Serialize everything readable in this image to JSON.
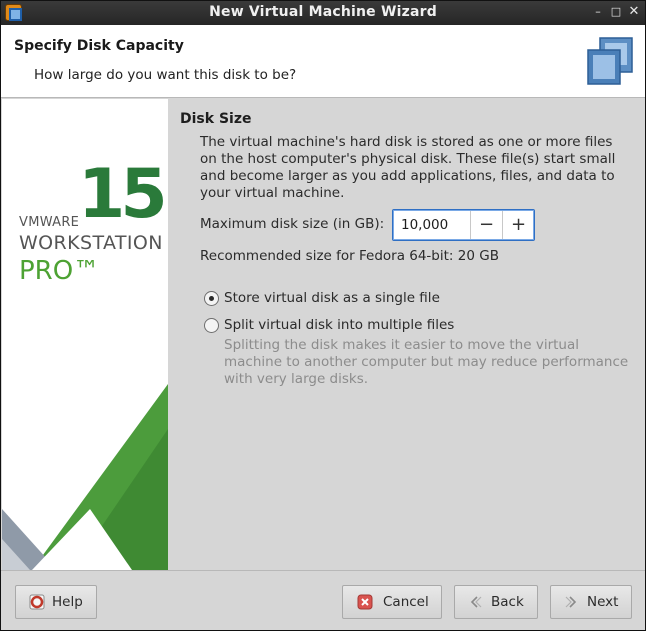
{
  "window": {
    "title": "New Virtual Machine Wizard",
    "min_glyph": "–",
    "max_glyph": "□",
    "close_glyph": "✕"
  },
  "header": {
    "title": "Specify Disk Capacity",
    "subtitle": "How large do you want this disk to be?"
  },
  "banner": {
    "version": "15",
    "brand": "VMWARE",
    "product": "WORKSTATION",
    "edition": "PRO™",
    "accent_green": "#4da233",
    "dark_green": "#2a7a3a"
  },
  "content": {
    "section_title": "Disk Size",
    "description": "The virtual machine's hard disk is stored as one or more files on the host computer's physical disk. These file(s) start small and become larger as you add applications, files, and data to your virtual machine.",
    "max_size_label": "Maximum disk size (in GB):",
    "max_size_value": "10,000",
    "decrement_glyph": "−",
    "increment_glyph": "+",
    "recommended": "Recommended size for Fedora 64-bit: 20 GB",
    "options": [
      {
        "label": "Store virtual disk as a single file",
        "selected": true
      },
      {
        "label": "Split virtual disk into multiple files",
        "selected": false
      }
    ],
    "split_note": "Splitting the disk makes it easier to move the virtual machine to another computer but may reduce performance with very large disks."
  },
  "footer": {
    "help_label": "Help",
    "cancel_label": "Cancel",
    "back_label": "Back",
    "next_label": "Next"
  },
  "icons": {
    "app": "vmware-app-icon",
    "header": "virtual-disk-icon",
    "help": "help-lifebuoy-icon",
    "cancel": "cancel-x-icon",
    "back": "back-chevron-icon",
    "next": "next-chevron-icon"
  }
}
